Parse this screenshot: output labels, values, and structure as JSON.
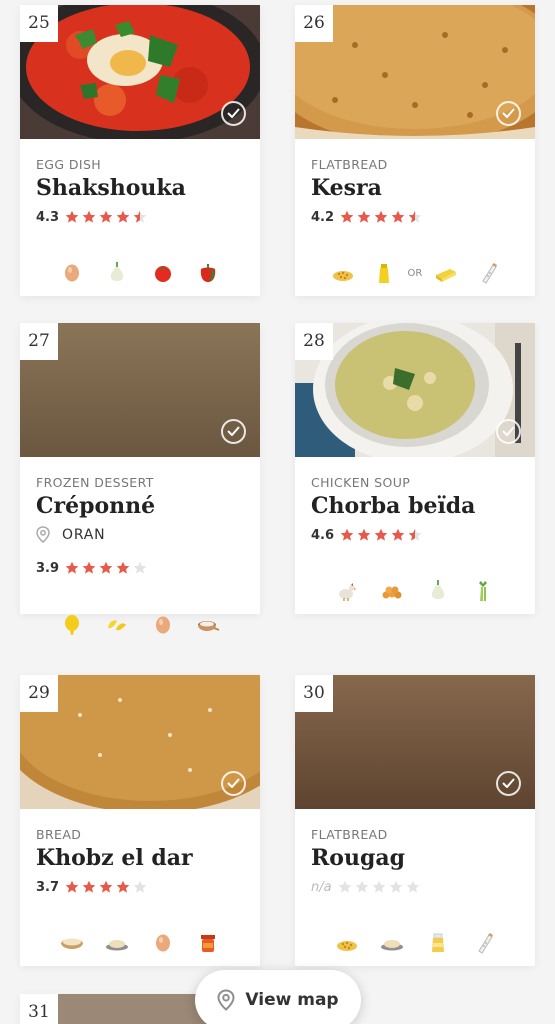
{
  "colors": {
    "star": "#e8594a",
    "star_empty": "#e3e3e3",
    "background": "#f4f4f4"
  },
  "recipes": [
    {
      "number": "25",
      "category": "EGG DISH",
      "name": "Shakshouka",
      "score": "4.3",
      "stars": 4.5,
      "ingredients": [
        "egg-icon",
        "onion-icon",
        "tomato-icon",
        "bell-pepper-icon"
      ]
    },
    {
      "number": "26",
      "category": "FLATBREAD",
      "name": "Kesra",
      "score": "4.2",
      "stars": 4.5,
      "ingredients": [
        "semolina-icon",
        "oil-bottle-icon",
        "or",
        "butter-icon",
        "salt-shaker-icon"
      ],
      "or_text": "OR"
    },
    {
      "number": "27",
      "category": "FROZEN DESSERT",
      "name": "Créponné",
      "location": "ORAN",
      "score": "3.9",
      "stars": 4,
      "ingredients": [
        "lemon-icon",
        "lemon-slices-icon",
        "egg-icon",
        "sugar-bowl-icon"
      ]
    },
    {
      "number": "28",
      "category": "CHICKEN SOUP",
      "name": "Chorba beïda",
      "score": "4.6",
      "stars": 4.5,
      "ingredients": [
        "chicken-icon",
        "chickpeas-icon",
        "onion-icon",
        "celery-icon"
      ]
    },
    {
      "number": "29",
      "category": "BREAD",
      "name": "Khobz el dar",
      "score": "3.7",
      "stars": 4,
      "ingredients": [
        "flour-bowl-icon",
        "flour-plate-icon",
        "egg-icon",
        "honey-jar-icon"
      ]
    },
    {
      "number": "30",
      "category": "FLATBREAD",
      "name": "Rougag",
      "score": "n/a",
      "stars": 0,
      "ingredients": [
        "semolina-icon",
        "flour-plate-icon",
        "ghee-jar-icon",
        "salt-shaker-icon"
      ]
    }
  ],
  "partial_card": {
    "number": "31"
  },
  "view_map": {
    "label": "View map",
    "icon": "map-pin-icon"
  }
}
